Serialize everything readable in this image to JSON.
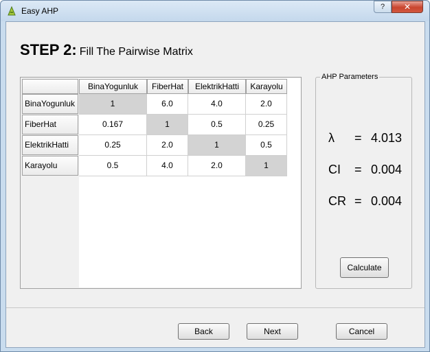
{
  "window": {
    "title": "Easy AHP",
    "help_label": "?",
    "close_label": "✕"
  },
  "step": {
    "label": "STEP 2:",
    "subtitle": "Fill The Pairwise Matrix"
  },
  "matrix": {
    "columns": [
      "BinaYogunluk",
      "FiberHat",
      "ElektrikHatti",
      "Karayolu"
    ],
    "rows": [
      {
        "name": "BinaYogunluk",
        "values": [
          "1",
          "6.0",
          "4.0",
          "2.0"
        ]
      },
      {
        "name": "FiberHat",
        "values": [
          "0.167",
          "1",
          "0.5",
          "0.25"
        ]
      },
      {
        "name": "ElektrikHatti",
        "values": [
          "0.25",
          "2.0",
          "1",
          "0.5"
        ]
      },
      {
        "name": "Karayolu",
        "values": [
          "0.5",
          "4.0",
          "2.0",
          "1"
        ]
      }
    ]
  },
  "params": {
    "legend": "AHP Parameters",
    "lambda": {
      "name": "λ",
      "eq": "=",
      "value": "4.013"
    },
    "ci": {
      "name": "CI",
      "eq": "=",
      "value": "0.004"
    },
    "cr": {
      "name": "CR",
      "eq": "=",
      "value": "0.004"
    },
    "calculate_label": "Calculate"
  },
  "footer": {
    "back_label": "Back",
    "next_label": "Next",
    "cancel_label": "Cancel"
  }
}
